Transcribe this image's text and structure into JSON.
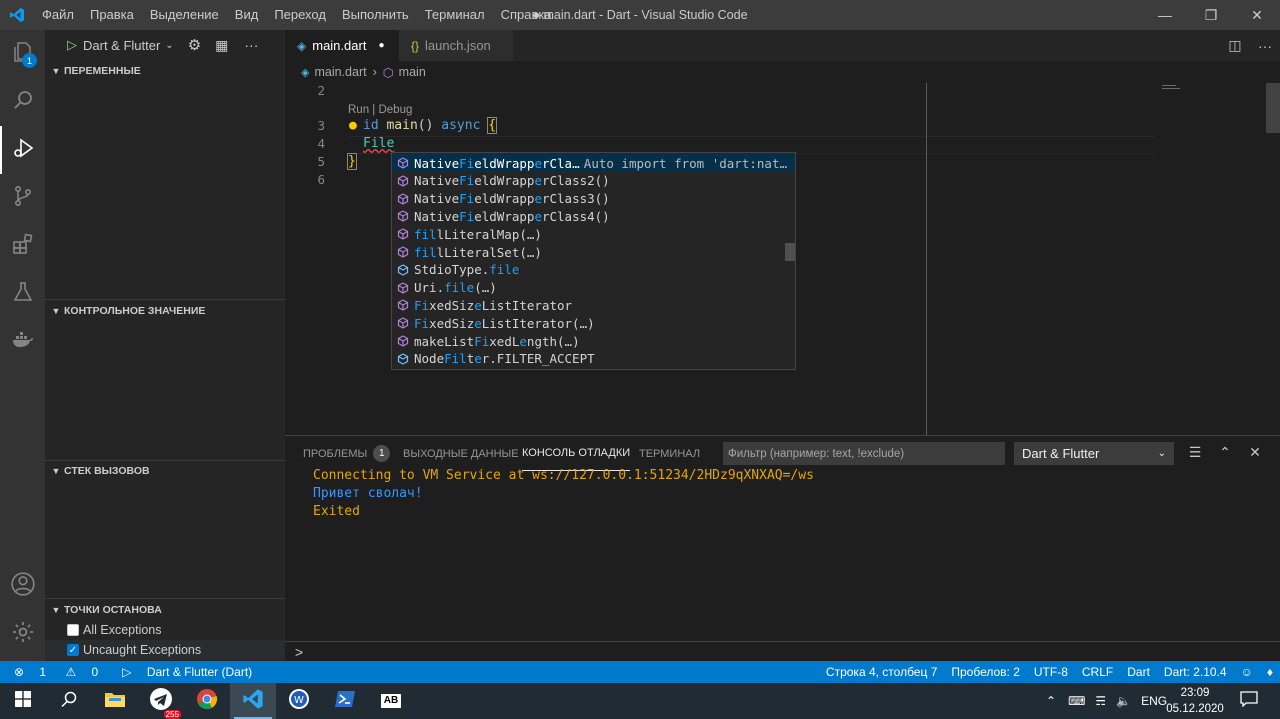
{
  "titlebar": {
    "menu": [
      "Файл",
      "Правка",
      "Выделение",
      "Вид",
      "Переход",
      "Выполнить",
      "Терминал",
      "Справка"
    ],
    "title": "● main.dart - Dart - Visual Studio Code"
  },
  "activity": {
    "explorer_badge": "1"
  },
  "sidebar": {
    "debug_config": "Dart & Flutter",
    "sections": {
      "variables": "ПЕРЕМЕННЫЕ",
      "watch": "КОНТРОЛЬНОЕ ЗНАЧЕНИЕ",
      "callstack": "СТЕК ВЫЗОВОВ",
      "breakpoints": "ТОЧКИ ОСТАНОВА"
    },
    "breakpoints": [
      {
        "label": "All Exceptions",
        "checked": false
      },
      {
        "label": "Uncaught Exceptions",
        "checked": true
      }
    ]
  },
  "tabs": [
    {
      "label": "main.dart",
      "modified": true
    },
    {
      "label": "launch.json"
    }
  ],
  "breadcrumb": {
    "file": "main.dart",
    "symbol": "main"
  },
  "editor": {
    "codelens": "Run | Debug",
    "lines": [
      "2",
      "3",
      "4",
      "5",
      "6"
    ],
    "line3": {
      "kw1": "id",
      "fn": "main",
      "paren": "()",
      "kw2": "async",
      "brace": "{"
    },
    "line4": "File",
    "line5": "}"
  },
  "suggest": {
    "detail": "Auto import from 'dart:nat…",
    "items": [
      {
        "pre": "Native",
        "hl": "Fi",
        "mid": "eldWrapp",
        "hl2": "e",
        "post": "rCla…",
        "kind": "class"
      },
      {
        "pre": "Native",
        "hl": "Fi",
        "mid": "eldWrapp",
        "hl2": "e",
        "post": "rClass2()",
        "kind": "class"
      },
      {
        "pre": "Native",
        "hl": "Fi",
        "mid": "eldWrapp",
        "hl2": "e",
        "post": "rClass3()",
        "kind": "class"
      },
      {
        "pre": "Native",
        "hl": "Fi",
        "mid": "eldWrapp",
        "hl2": "e",
        "post": "rClass4()",
        "kind": "class"
      },
      {
        "pre": "",
        "hl": "fil",
        "mid": "lLiteralMap(…)",
        "hl2": "",
        "post": "",
        "kind": "method"
      },
      {
        "pre": "",
        "hl": "fil",
        "mid": "lLiteralSet(…)",
        "hl2": "",
        "post": "",
        "kind": "method"
      },
      {
        "pre": "StdioType.",
        "hl": "file",
        "mid": "",
        "hl2": "",
        "post": "",
        "kind": "field"
      },
      {
        "pre": "Uri.",
        "hl": "file",
        "mid": "(…)",
        "hl2": "",
        "post": "",
        "kind": "method"
      },
      {
        "pre": "",
        "hl": "Fi",
        "mid": "xedSiz",
        "hl2": "e",
        "post": "ListIterator",
        "kind": "class"
      },
      {
        "pre": "",
        "hl": "Fi",
        "mid": "xedSiz",
        "hl2": "e",
        "post": "ListIterator(…)",
        "kind": "class"
      },
      {
        "pre": "makeList",
        "hl": "Fi",
        "mid": "xedL",
        "hl2": "e",
        "post": "ngth(…)",
        "kind": "method"
      },
      {
        "pre": "Node",
        "hl": "Fil",
        "mid": "t",
        "hl2": "e",
        "post": "r.FILTER_ACCEPT",
        "kind": "field"
      }
    ]
  },
  "panel": {
    "tabs": [
      "ПРОБЛЕМЫ",
      "ВЫХОДНЫЕ ДАННЫЕ",
      "КОНСОЛЬ ОТЛАДКИ",
      "ТЕРМИНАЛ"
    ],
    "problems_count": "1",
    "filter_placeholder": "Фильтр (например: text, !exclude)",
    "select": "Dart & Flutter",
    "output": [
      {
        "text": "Connecting to VM Service at ws://127.0.0.1:51234/2HDz9qXNXAQ=/ws",
        "color": "#e5a50a"
      },
      {
        "text": "Привет сволач!",
        "color": "#3794ff"
      },
      {
        "text": "Exited",
        "color": "#e5a50a"
      }
    ],
    "prompt": ">"
  },
  "status": {
    "errors": "1",
    "warnings": "0",
    "debug": "Dart & Flutter (Dart)",
    "position": "Строка 4, столбец 7",
    "spaces": "Пробелов: 2",
    "encoding": "UTF-8",
    "eol": "CRLF",
    "language": "Dart",
    "sdk": "Dart: 2.10.4"
  },
  "taskbar": {
    "telegram_badge": "255",
    "lang": "ENG",
    "time": "23:09",
    "date": "05.12.2020",
    "abbyy_label": "AB"
  },
  "colors": {
    "accent": "#007acc",
    "editor_bg": "#1e1e1e",
    "sidebar_bg": "#252526",
    "highlight": "#18a3ff"
  }
}
